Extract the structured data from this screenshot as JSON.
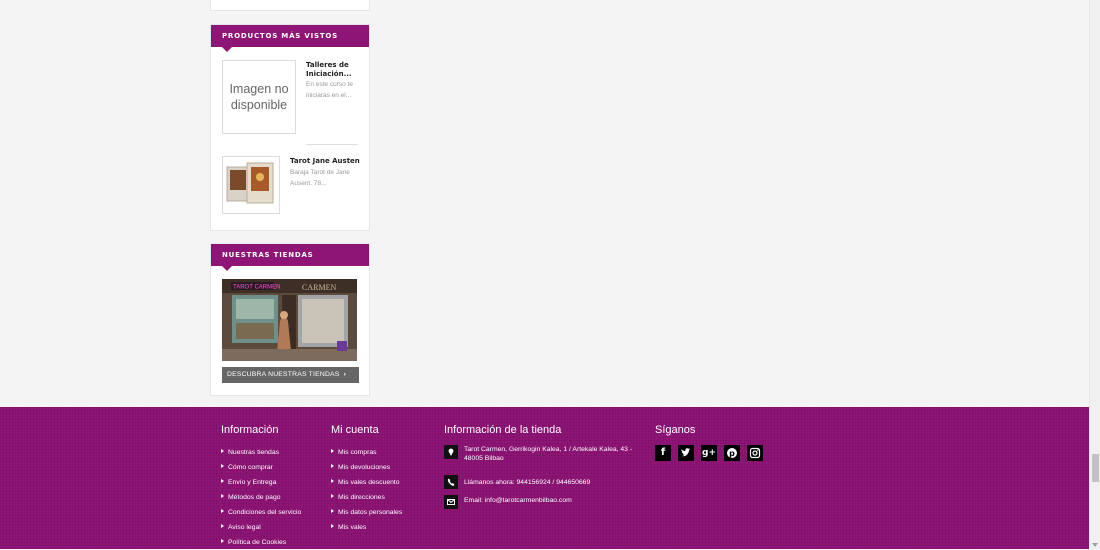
{
  "viewed_block": {
    "title": "PRODUCTOS MÁS VISTOS",
    "products": [
      {
        "placeholder": "Imagen no disponible",
        "name": "Talleres de Iniciación...",
        "desc": "En este curso te iniciaras en el..."
      },
      {
        "name": "Tarot Jane Austen",
        "desc": "Baraja Tarot de Jane Ausent. 78..."
      }
    ]
  },
  "stores_block": {
    "title": "NUESTRAS TIENDAS",
    "sign_left": "TAROT CARMEN",
    "sign_right": "CARMEN",
    "button_label": "DESCUBRA NUESTRAS TIENDAS",
    "button_icon": "chevron-right-icon"
  },
  "footer": {
    "info_title": "Información",
    "info_links": [
      "Nuestras tiendas",
      "Cómo comprar",
      "Envío y Entrega",
      "Métodos de pago",
      "Condiciones del servicio",
      "Aviso legal",
      "Política de Cookies"
    ],
    "account_title": "Mi cuenta",
    "account_links": [
      "Mis compras",
      "Mis devoluciones",
      "Mis vales descuento",
      "Mis direcciones",
      "Mis datos personales",
      "Mis vales"
    ],
    "store_title": "Información de la tienda",
    "address": "Tarot Carmen, Gerrikogin Kalea, 1 / Artekale Kalea, 43 - 48005 Bilbao",
    "phone": "Llámanos ahora: 944156924 / 944650669",
    "email": "Email: info@tarotcarmenbilbao.com",
    "follow_title": "Síganos",
    "social_icons": [
      "facebook-icon",
      "twitter-icon",
      "google-plus-icon",
      "pinterest-icon",
      "instagram-icon"
    ]
  },
  "colors": {
    "brand": "#8e1476",
    "button": "#666666"
  }
}
